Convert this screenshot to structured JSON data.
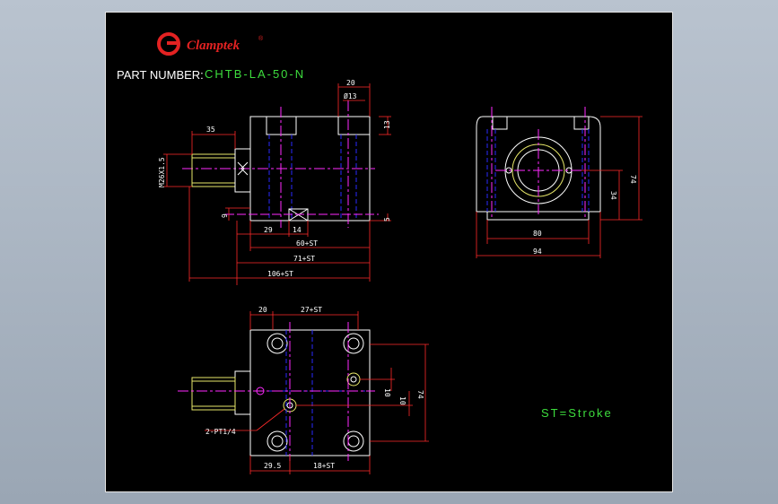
{
  "brand": {
    "name": "Clamptek",
    "logo_letter": "G",
    "reg_mark": "®",
    "color": "#e32222"
  },
  "part_number": {
    "label": "PART NUMBER:",
    "value": "CHTB-LA-50-N"
  },
  "legend": {
    "text": "ST=Stroke"
  },
  "dimensions": {
    "side_top_width": "20",
    "side_hole_dia": "Ø13",
    "side_top_height": "13",
    "thread_length": "35",
    "thread_spec": "M26X1.5",
    "port_offset_left": "9",
    "port_offset_right": "5",
    "port_x1": "29",
    "port_x2": "14",
    "body_length": "60+ST",
    "total_length_1": "71+ST",
    "total_length_2": "106+ST",
    "end_height": "74",
    "end_center_height": "34",
    "end_inner_width": "80",
    "end_width": "94",
    "plan_left": "20",
    "plan_mid": "27+ST",
    "plan_port_y1": "10",
    "plan_port_y2": "10",
    "plan_height": "74",
    "plan_port_label": "2-PT1/4",
    "plan_bottom_left": "29.5",
    "plan_bottom_right": "18+ST"
  },
  "colors": {
    "outline": "#ffffff",
    "hidden": "#2a2aff",
    "center": "#ff2aff",
    "dimension": "#ff2a2a",
    "thread": "#e8e86a",
    "label_green": "#3ddc3d"
  }
}
